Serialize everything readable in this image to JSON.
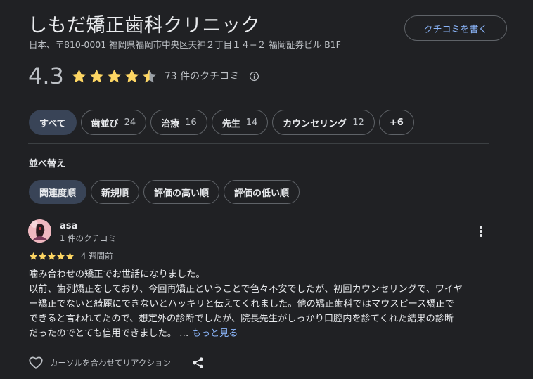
{
  "business": {
    "name": "しもだ矯正歯科クリニック",
    "address": "日本、〒810-0001 福岡県福岡市中央区天神２丁目１４−２ 福岡証券ビル B1F",
    "write_review_label": "クチコミを書く"
  },
  "rating": {
    "value": "4.3",
    "stars": 4.3,
    "count_label": "73 件のクチコミ",
    "star_color": "#fdd663",
    "info_icon": "info-icon"
  },
  "topics": [
    {
      "label": "すべて",
      "count": "",
      "active": true
    },
    {
      "label": "歯並び",
      "count": "24"
    },
    {
      "label": "治療",
      "count": "16"
    },
    {
      "label": "先生",
      "count": "14"
    },
    {
      "label": "カウンセリング",
      "count": "12"
    },
    {
      "label": "+6",
      "count": ""
    }
  ],
  "sort": {
    "label": "並べ替え",
    "options": [
      {
        "label": "関連度順",
        "active": true
      },
      {
        "label": "新規順"
      },
      {
        "label": "評価の高い順"
      },
      {
        "label": "評価の低い順"
      }
    ]
  },
  "review": {
    "author": "asa",
    "author_meta": "1 件のクチコミ",
    "stars": 5,
    "date": "4 週間前",
    "lines": [
      "噛み合わせの矯正でお世話になりました。",
      "以前、歯列矯正をしており、今回再矯正ということで色々不安でしたが、初回カウンセリングで、ワイヤ",
      "ー矯正でないと綺麗にできないとハッキリと伝えてくれました。他の矯正歯科ではマウスピース矯正で",
      "できると言われてたので、想定外の診断でしたが、院長先生がしっかり口腔内を診てくれた結果の診断",
      "だったのでとても信用できました。 … "
    ],
    "more_label": "もっと見る",
    "reaction_label": "カーソルを合わせてリアクション"
  }
}
